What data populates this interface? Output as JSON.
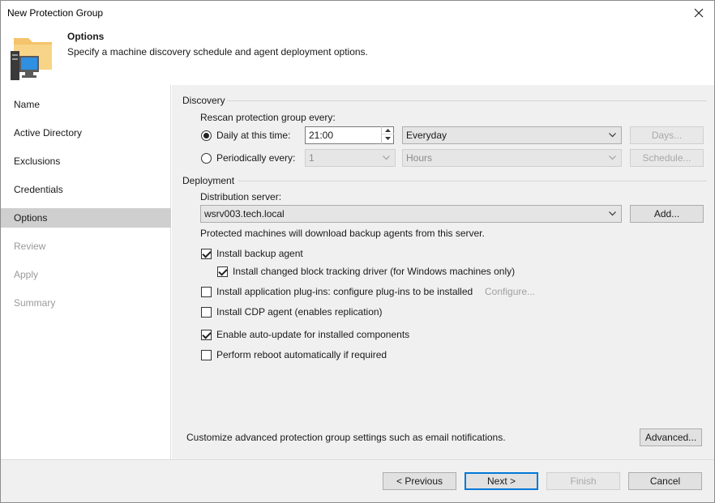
{
  "window": {
    "title": "New Protection Group"
  },
  "header": {
    "title": "Options",
    "description": "Specify a machine discovery schedule and agent deployment options."
  },
  "sidebar": {
    "items": [
      {
        "label": "Name",
        "state": "normal"
      },
      {
        "label": "Active Directory",
        "state": "normal"
      },
      {
        "label": "Exclusions",
        "state": "normal"
      },
      {
        "label": "Credentials",
        "state": "normal"
      },
      {
        "label": "Options",
        "state": "active"
      },
      {
        "label": "Review",
        "state": "disabled"
      },
      {
        "label": "Apply",
        "state": "disabled"
      },
      {
        "label": "Summary",
        "state": "disabled"
      }
    ]
  },
  "discovery": {
    "section_title": "Discovery",
    "rescan_label": "Rescan protection group every:",
    "daily_label": "Daily at this time:",
    "daily_checked": true,
    "daily_time": "21:00",
    "daily_frequency": "Everyday",
    "days_button": "Days...",
    "periodic_label": "Periodically every:",
    "periodic_checked": false,
    "periodic_value": "1",
    "periodic_unit": "Hours",
    "schedule_button": "Schedule..."
  },
  "deployment": {
    "section_title": "Deployment",
    "distribution_label": "Distribution server:",
    "distribution_server": "wsrv003.tech.local",
    "add_button": "Add...",
    "distribution_note": "Protected machines will download backup agents from this server.",
    "install_backup_agent": {
      "label": "Install backup agent",
      "checked": true
    },
    "install_cbt_driver": {
      "label": "Install changed block tracking driver (for Windows machines only)",
      "checked": true
    },
    "install_plugins": {
      "label": "Install application plug-ins: configure plug-ins to be installed",
      "checked": false
    },
    "configure_link": "Configure...",
    "install_cdp": {
      "label": "Install CDP agent (enables replication)",
      "checked": false
    },
    "auto_update": {
      "label": "Enable auto-update for installed components",
      "checked": true
    },
    "auto_reboot": {
      "label": "Perform reboot automatically if required",
      "checked": false
    }
  },
  "advanced": {
    "note": "Customize advanced protection group settings such as email notifications.",
    "button": "Advanced..."
  },
  "footer": {
    "previous": "< Previous",
    "next": "Next >",
    "finish": "Finish",
    "cancel": "Cancel"
  }
}
